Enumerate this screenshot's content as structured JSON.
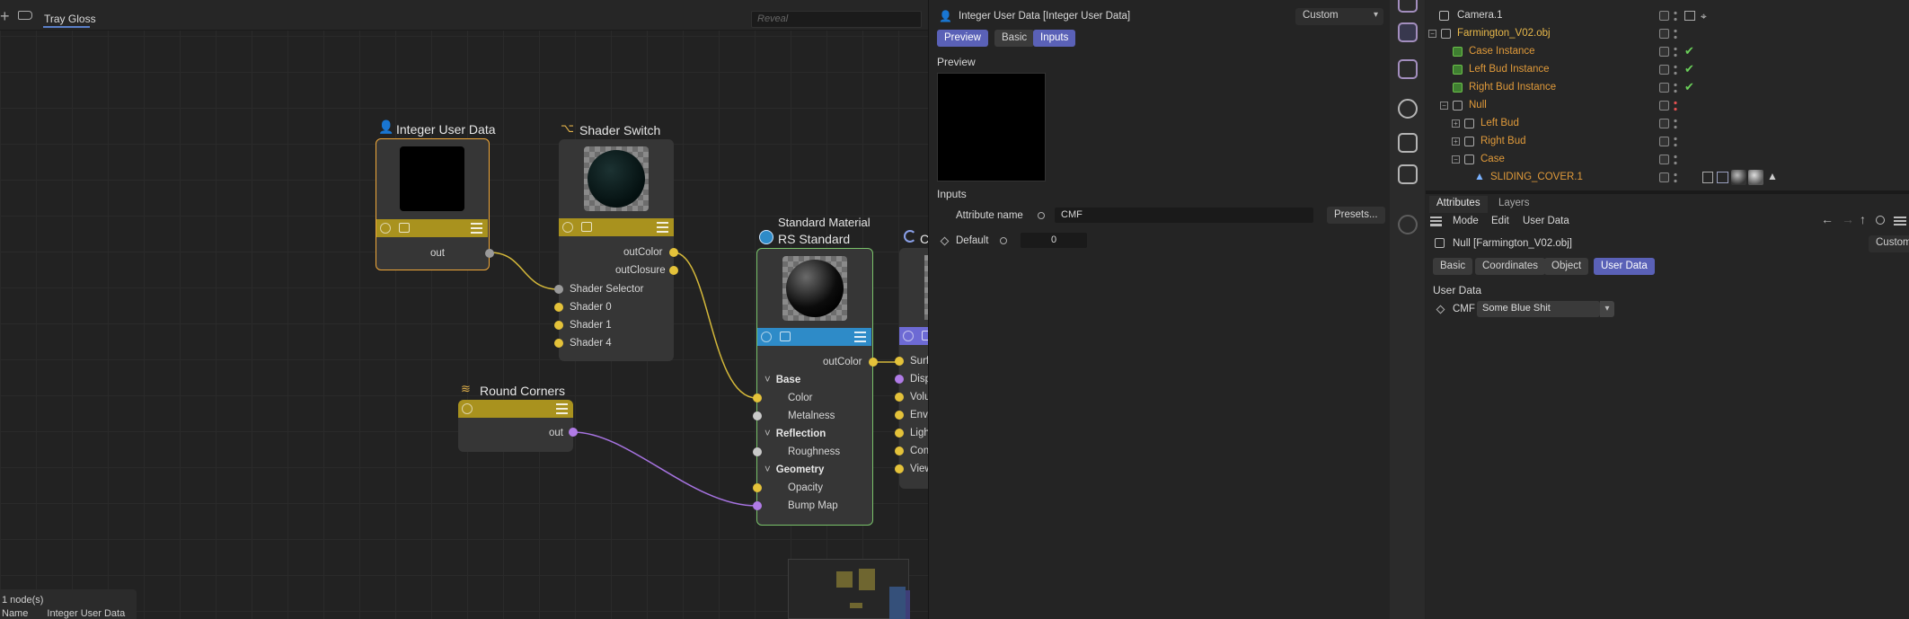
{
  "node_editor": {
    "breadcrumb": "Tray Gloss",
    "reveal_placeholder": "Reveal",
    "nodes": {
      "integer_user_data": {
        "title": "Integer User Data",
        "out_port": "out"
      },
      "shader_switch": {
        "title": "Shader Switch",
        "outputs": [
          "outColor",
          "outClosure"
        ],
        "inputs": [
          "Shader Selector",
          "Shader 0",
          "Shader 1",
          "Shader 4"
        ]
      },
      "round_corners": {
        "title": "Round Corners",
        "out_port": "out"
      },
      "rs_standard": {
        "subtitle": "Standard Material",
        "title": "RS Standard",
        "output": "outColor",
        "groups": {
          "base": {
            "label": "Base",
            "ports": [
              "Color",
              "Metalness"
            ]
          },
          "reflection": {
            "label": "Reflection",
            "ports": [
              "Roughness"
            ]
          },
          "geometry": {
            "label": "Geometry",
            "ports": [
              "Opacity",
              "Bump Map"
            ]
          }
        }
      },
      "output_node": {
        "title_partial": "C",
        "ports": [
          "Surf",
          "Disp",
          "Volu",
          "Envi",
          "Ligh",
          "Con",
          "View"
        ]
      }
    },
    "node_info": {
      "count": "1 node(s)",
      "name_label": "Name",
      "name_value": "Integer User Data"
    }
  },
  "attributes_panel": {
    "title": "Integer User Data [Integer User Data]",
    "mode_dropdown": "Custom",
    "tabs": [
      "Preview",
      "Basic",
      "Inputs"
    ],
    "active_tabs": [
      "Preview",
      "Inputs"
    ],
    "preview_heading": "Preview",
    "inputs_heading": "Inputs",
    "attribute_name_label": "Attribute name",
    "attribute_name_value": "CMF",
    "presets_button": "Presets...",
    "default_label": "Default",
    "default_value": "0"
  },
  "object_manager": {
    "rows": [
      {
        "name": "Camera.1",
        "color": "white",
        "indent": 0
      },
      {
        "name": "Farmington_V02.obj",
        "color": "orange",
        "indent": 0
      },
      {
        "name": "Case Instance",
        "color": "orange",
        "indent": 1,
        "checked": true
      },
      {
        "name": "Left Bud Instance",
        "color": "orange",
        "indent": 1,
        "checked": true
      },
      {
        "name": "Right Bud Instance",
        "color": "orange",
        "indent": 1,
        "checked": true
      },
      {
        "name": "Null",
        "color": "orange",
        "indent": 1
      },
      {
        "name": "Left Bud",
        "color": "orange",
        "indent": 2
      },
      {
        "name": "Right Bud",
        "color": "orange",
        "indent": 2
      },
      {
        "name": "Case",
        "color": "orange",
        "indent": 2
      },
      {
        "name": "SLIDING_COVER.1",
        "color": "orange",
        "indent": 3
      }
    ]
  },
  "attributes2": {
    "tabs": [
      "Attributes",
      "Layers"
    ],
    "menu": [
      "Mode",
      "Edit",
      "User Data"
    ],
    "object_title": "Null [Farmington_V02.obj]",
    "mode_dropdown": "Custom",
    "sub_tabs": [
      "Basic",
      "Coordinates",
      "Object",
      "User Data"
    ],
    "active_sub_tab": "User Data",
    "section": "User Data",
    "cmf_label": "CMF",
    "cmf_value": "Some Blue Shit"
  },
  "colors": {
    "accent": "#5a61b7",
    "node_bar_yellow": "#a9921e",
    "node_bar_blue": "#2e8bc8",
    "node_bar_purple": "#6d6ad4",
    "selected_outline": "#f0a83a",
    "material_outline": "#79c26a",
    "wire_yellow": "#d4b83a",
    "wire_purple": "#a673e0",
    "orange_text": "#e09a3a"
  }
}
